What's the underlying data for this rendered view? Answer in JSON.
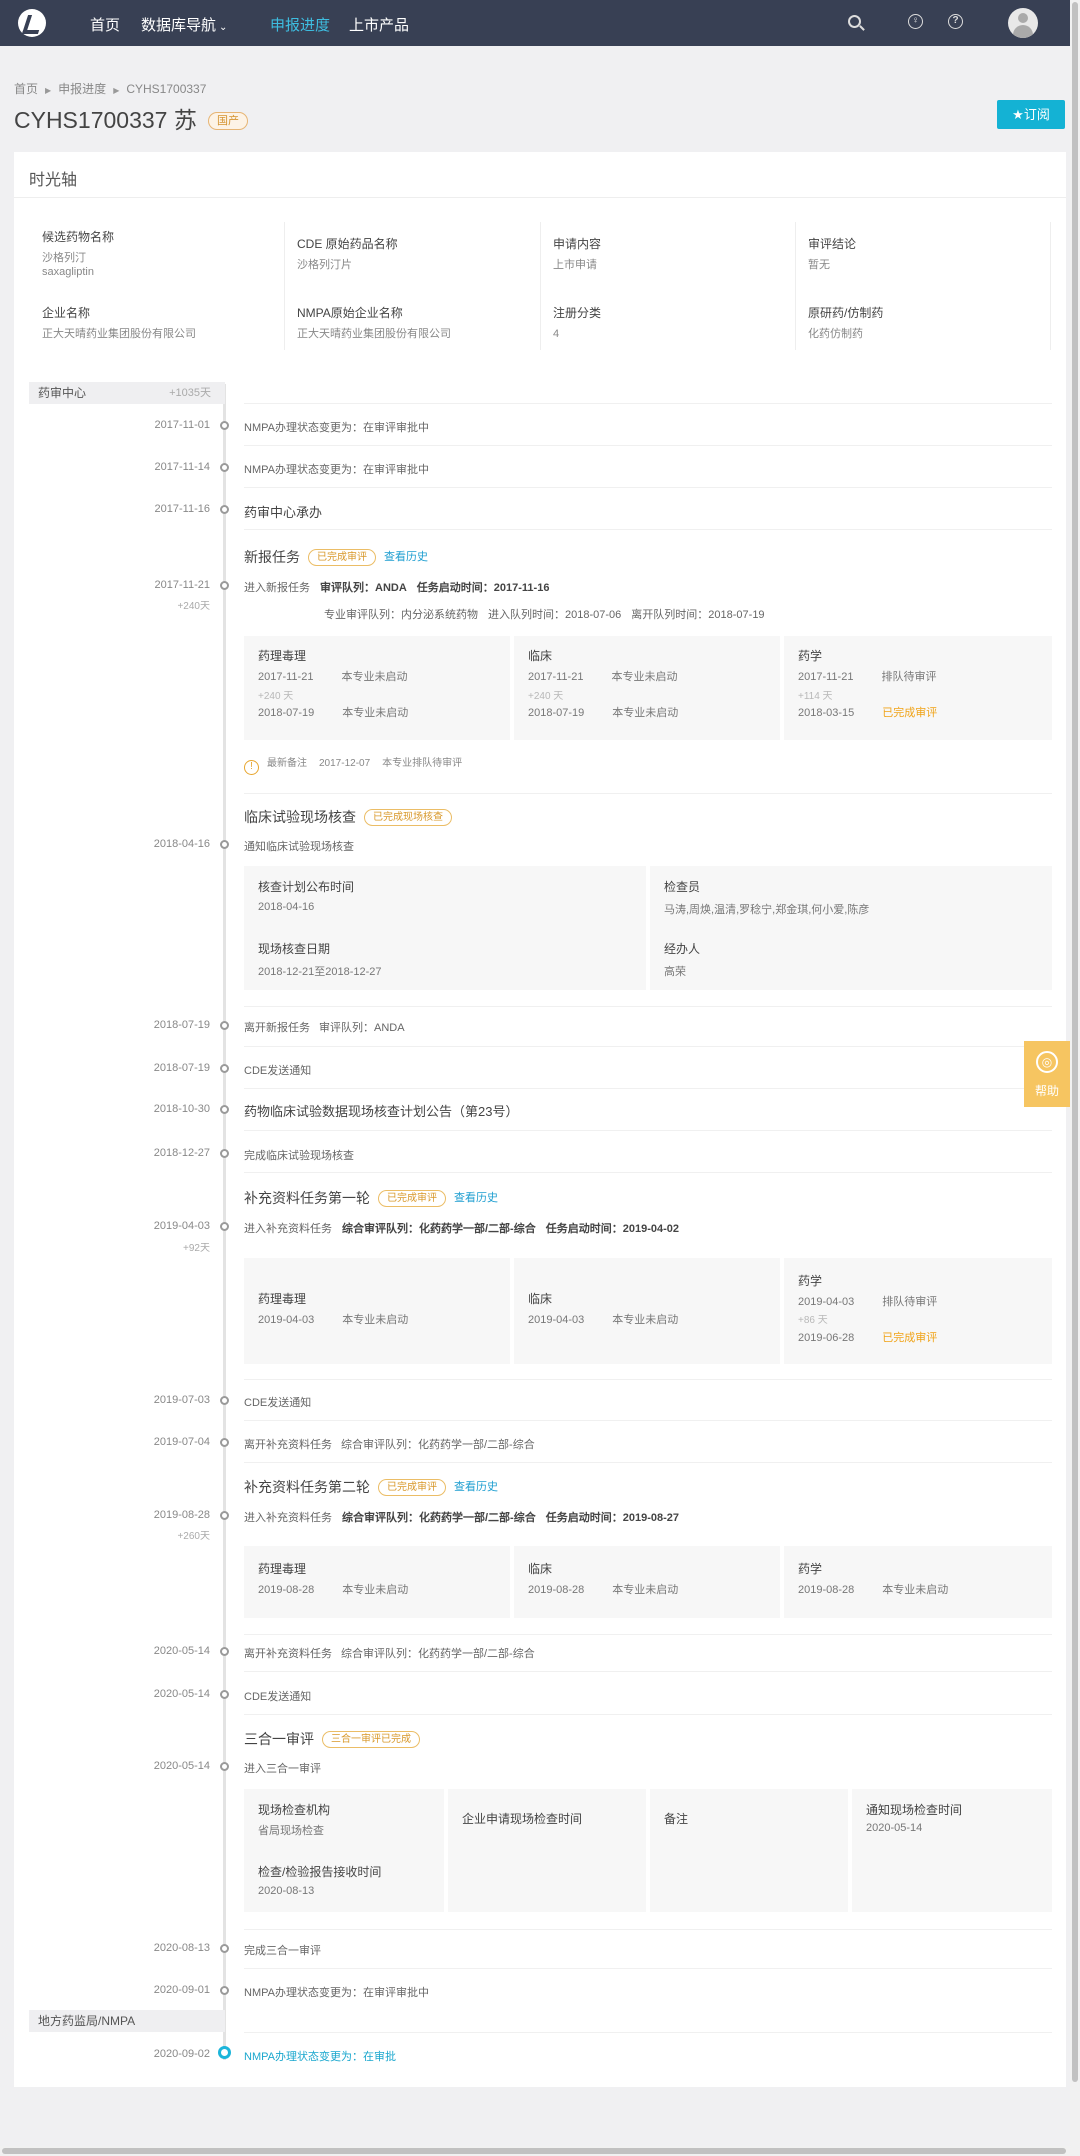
{
  "nav": {
    "items": [
      "首页",
      "数据库导航",
      "申报进度",
      "上市产品"
    ]
  },
  "breadcrumb": [
    "首页",
    "申报进度",
    "CYHS1700337"
  ],
  "title": "CYHS1700337 苏",
  "title_tag": "国产",
  "subscribe": "★订阅",
  "card_title": "时光轴",
  "info": [
    {
      "label": "候选药物名称",
      "value": "沙格列汀",
      "value2": "saxagliptin"
    },
    {
      "label": "CDE 原始药品名称",
      "value": "沙格列汀片"
    },
    {
      "label": "申请内容",
      "value": "上市申请"
    },
    {
      "label": "审评结论",
      "value": "暂无"
    },
    {
      "label": "企业名称",
      "value": "正大天晴药业集团股份有限公司"
    },
    {
      "label": "NMPA原始企业名称",
      "value": "正大天晴药业集团股份有限公司"
    },
    {
      "label": "注册分类",
      "value": "4"
    },
    {
      "label": "原研药/仿制药",
      "value": "化药仿制药"
    }
  ],
  "sec1": {
    "name": "药审中心",
    "count": "+1035天"
  },
  "sec2": {
    "name": "地方药监局/NMPA"
  },
  "ev": {
    "e1": {
      "date": "2017-11-01",
      "text": "NMPA办理状态变更为：在审评审批中"
    },
    "e2": {
      "date": "2017-11-14",
      "text": "NMPA办理状态变更为：在审评审批中"
    },
    "e3": {
      "date": "2017-11-16",
      "text": "药审中心承办"
    },
    "t1": {
      "title": "新报任务",
      "tag": "已完成审评",
      "hist": "查看历史",
      "date": "2017-11-21",
      "plus": "+240天",
      "enter": "进入新报任务",
      "queue": "审评队列：ANDA",
      "start": "任务启动时间：2017-11-16",
      "line2": "专业审评队列：内分泌系统药物",
      "line2b": "进入队列时间：2018-07-06",
      "line2c": "离开队列时间：2018-07-19"
    },
    "e7": {
      "date": "2018-07-19",
      "text": "离开新报任务",
      "text2": "审评队列：ANDA"
    },
    "e8": {
      "date": "2018-07-19",
      "text": "CDE发送通知"
    },
    "e9": {
      "date": "2018-10-30",
      "text": "药物临床试验数据现场核查计划公告（第23号）"
    },
    "e10": {
      "date": "2018-12-27",
      "text": "完成临床试验现场核查"
    },
    "e12": {
      "date": "2019-07-03",
      "text": "CDE发送通知"
    },
    "e13": {
      "date": "2019-07-04",
      "text": "离开补充资料任务",
      "text2": "综合审评队列：化药药学一部/二部-综合"
    },
    "e15": {
      "date": "2020-05-14",
      "text": "离开补充资料任务",
      "text2": "综合审评队列：化药药学一部/二部-综合"
    },
    "e16": {
      "date": "2020-05-14",
      "text": "CDE发送通知"
    },
    "e18": {
      "date": "2020-08-13",
      "text": "完成三合一审评"
    },
    "e19": {
      "date": "2020-09-01",
      "text": "NMPA办理状态变更为：在审评审批中"
    },
    "e20": {
      "date": "2020-09-02",
      "text": "NMPA办理状态变更为：在审批"
    }
  },
  "t1box": [
    {
      "h": "药理毒理",
      "d1": "2017-11-21",
      "s1": "本专业未启动",
      "plus": "+240 天",
      "d2": "2018-07-19",
      "s2": "本专业未启动"
    },
    {
      "h": "临床",
      "d1": "2017-11-21",
      "s1": "本专业未启动",
      "plus": "+240 天",
      "d2": "2018-07-19",
      "s2": "本专业未启动"
    },
    {
      "h": "药学",
      "d1": "2017-11-21",
      "s1": "排队待审评",
      "plus": "+114 天",
      "d2": "2018-03-15",
      "s2": "已完成审评"
    }
  ],
  "note1": {
    "label": "最新备注",
    "date": "2017-12-07",
    "text": "本专业排队待审评"
  },
  "insp": {
    "title": "临床试验现场核查",
    "tag": "已完成现场核查",
    "date": "2018-04-16",
    "text": "通知临床试验现场核查",
    "c1h": "核查计划公布时间",
    "c1v": "2018-04-16",
    "c2h": "检查员",
    "c2v": "马涛,周焕,温清,罗稔宁,郑金琪,何小爱,陈彦",
    "c3h": "现场核查日期",
    "c3v": "2018-12-21至2018-12-27",
    "c4h": "经办人",
    "c4v": "高荣"
  },
  "t2": {
    "title": "补充资料任务第一轮",
    "tag": "已完成审评",
    "hist": "查看历史",
    "date": "2019-04-03",
    "plus": "+92天",
    "enter": "进入补充资料任务",
    "queue": "综合审评队列：化药药学一部/二部-综合",
    "start": "任务启动时间：2019-04-02"
  },
  "t2box": [
    {
      "h": "药理毒理",
      "d1": "2019-04-03",
      "s1": "本专业未启动"
    },
    {
      "h": "临床",
      "d1": "2019-04-03",
      "s1": "本专业未启动"
    },
    {
      "h": "药学",
      "d1": "2019-04-03",
      "s1": "排队待审评",
      "plus": "+86 天",
      "d2": "2019-06-28",
      "s2": "已完成审评"
    }
  ],
  "t3": {
    "title": "补充资料任务第二轮",
    "tag": "已完成审评",
    "hist": "查看历史",
    "date": "2019-08-28",
    "plus": "+260天",
    "enter": "进入补充资料任务",
    "queue": "综合审评队列：化药药学一部/二部-综合",
    "start": "任务启动时间：2019-08-27"
  },
  "t3box": [
    {
      "h": "药理毒理",
      "d1": "2019-08-28",
      "s1": "本专业未启动"
    },
    {
      "h": "临床",
      "d1": "2019-08-28",
      "s1": "本专业未启动"
    },
    {
      "h": "药学",
      "d1": "2019-08-28",
      "s1": "本专业未启动"
    }
  ],
  "t4": {
    "title": "三合一审评",
    "tag": "三合一审评已完成",
    "date": "2020-05-14",
    "text": "进入三合一审评",
    "c1h": "现场检查机构",
    "c1v": "省局现场检查",
    "c1h2": "检查/检验报告接收时间",
    "c1v2": "2020-08-13",
    "c2h": "企业申请现场检查时间",
    "c3h": "备注",
    "c4h": "通知现场检查时间",
    "c4v": "2020-05-14"
  },
  "help": "帮助"
}
